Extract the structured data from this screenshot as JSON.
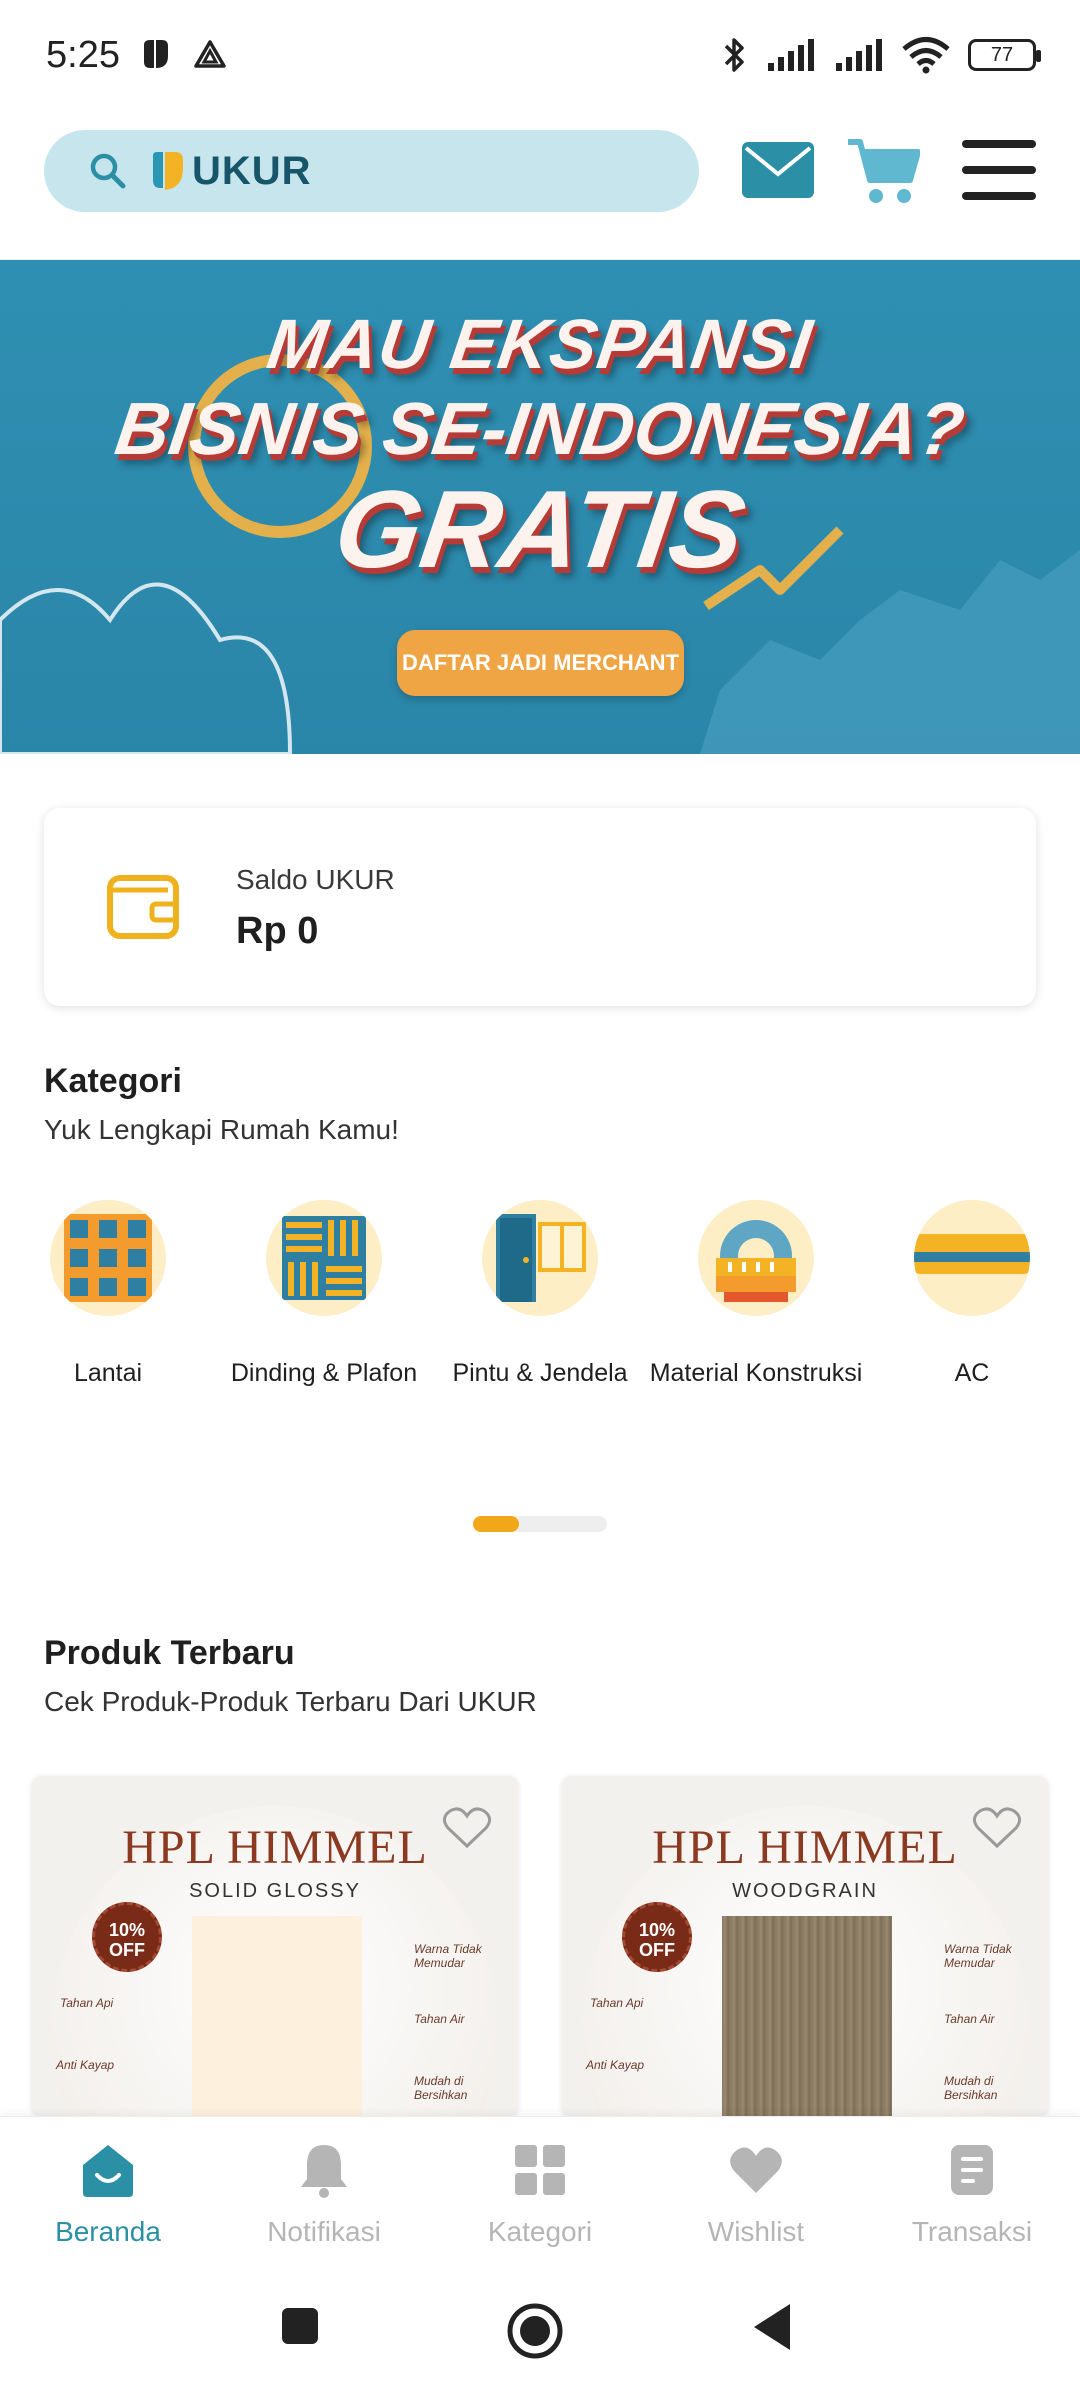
{
  "status_bar": {
    "time": "5:25",
    "battery": "77"
  },
  "header": {
    "logo_text": "UKUR",
    "icons": [
      "search-icon",
      "mail-icon",
      "cart-icon",
      "menu-icon"
    ]
  },
  "banner": {
    "line1": "MAU EKSPANSI",
    "line2": "BISNIS SE-INDONESIA?",
    "line3": "GRATIS",
    "cta": "DAFTAR JADI MERCHANT"
  },
  "saldo": {
    "label": "Saldo UKUR",
    "value": "Rp 0"
  },
  "kategori": {
    "title": "Kategori",
    "subtitle": "Yuk Lengkapi Rumah Kamu!",
    "items": [
      {
        "label": "Lantai",
        "icon": "floor-tile-icon"
      },
      {
        "label": "Dinding & Plafon",
        "icon": "wall-ceiling-icon"
      },
      {
        "label": "Pintu & Jendela",
        "icon": "door-window-icon"
      },
      {
        "label": "Material Konstruksi",
        "icon": "construction-material-icon"
      },
      {
        "label": "AC",
        "icon": "air-conditioner-icon"
      }
    ]
  },
  "produk": {
    "title": "Produk Terbaru",
    "subtitle": "Cek Produk-Produk Terbaru Dari UKUR",
    "items": [
      {
        "brand": "HPL HIMMEL",
        "variant": "SOLID GLOSSY",
        "badge": "10% OFF",
        "swatch": "#fdf0dc",
        "notes": [
          "Tahan Api",
          "Anti Kayap",
          "Warna Tidak Memudar",
          "Tahan Air",
          "Mudah di Bersihkan"
        ]
      },
      {
        "brand": "HPL HIMMEL",
        "variant": "WOODGRAIN",
        "badge": "10% OFF",
        "swatch": "#8a7a62",
        "notes": [
          "Tahan Api",
          "Anti Kayap",
          "Warna Tidak Memudar",
          "Tahan Air",
          "Mudah di Bersihkan"
        ]
      }
    ]
  },
  "bottom_nav": [
    {
      "label": "Beranda",
      "icon": "home-icon",
      "active": true
    },
    {
      "label": "Notifikasi",
      "icon": "bell-icon",
      "active": false
    },
    {
      "label": "Kategori",
      "icon": "grid-icon",
      "active": false
    },
    {
      "label": "Wishlist",
      "icon": "heart-icon",
      "active": false
    },
    {
      "label": "Transaksi",
      "icon": "receipt-icon",
      "active": false
    }
  ],
  "colors": {
    "accent": "#2b8fa5",
    "search_bg": "#c7e5ec",
    "banner_bg": "#2f8fb2",
    "cta": "#f0a545",
    "wallet": "#f0b21c",
    "inactive": "#b5b5b5"
  }
}
